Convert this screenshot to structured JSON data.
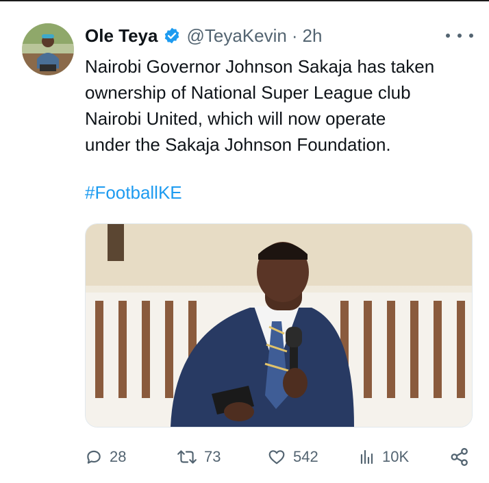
{
  "tweet": {
    "author_name": "Ole Teya",
    "handle": "@TeyaKevin",
    "separator": "·",
    "time": "2h",
    "text": "Nairobi Governor Johnson Sakaja has taken\nownership of National Super League club\nNairobi United, which will now operate\nunder the Sakaja Johnson Foundation.",
    "hashtag": "#FootballKE"
  },
  "actions": {
    "replies": "28",
    "retweets": "73",
    "likes": "542",
    "views": "10K"
  },
  "icons": {
    "verified": "verified-badge-icon",
    "more": "more-options-icon",
    "reply": "reply-icon",
    "retweet": "retweet-icon",
    "like": "heart-icon",
    "views": "views-chart-icon",
    "share": "share-icon"
  },
  "colors": {
    "accent": "#1d9bf0",
    "text": "#0f1419",
    "secondary": "#536471"
  }
}
